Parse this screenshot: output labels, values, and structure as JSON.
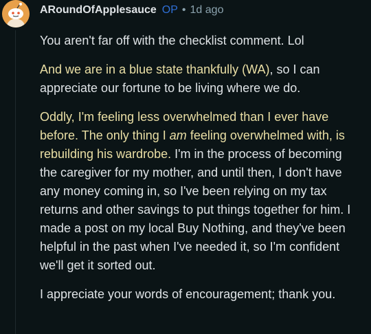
{
  "comment": {
    "username": "ARoundOfApplesauce",
    "op_badge": "OP",
    "separator": "•",
    "time": "1d ago",
    "p1": {
      "l1": "You aren't far off with the checklist comment. Lol"
    },
    "p2": {
      "l1_hl": "And we are in a blue state thankfully (WA)",
      "l1_rest": ", so I can",
      "l2": "appreciate our fortune to be living where we do."
    },
    "p3": {
      "l1_hl": "Oddly, I'm feeling less overwhelmed than I ever have",
      "l2_hl_a": "before. The only thing I ",
      "l2_hl_em": "am",
      "l2_hl_b": " feeling overwhelmed with, is",
      "l3_hl": "rebuilding his wardrobe.",
      "l3_rest": " I'm in the process of becoming",
      "l4": "the caregiver for my mother, and until then, I don't have",
      "l5": "any money coming in, so I've been relying on my tax",
      "l6": "returns and other savings to put things together for him. I",
      "l7": "made a post on my local Buy Nothing, and they've been",
      "l8": "helpful in the past when I've needed it, so I'm confident",
      "l9": "we'll get it sorted out."
    },
    "p4": {
      "l1": "I appreciate your words of encouragement; thank you."
    }
  }
}
